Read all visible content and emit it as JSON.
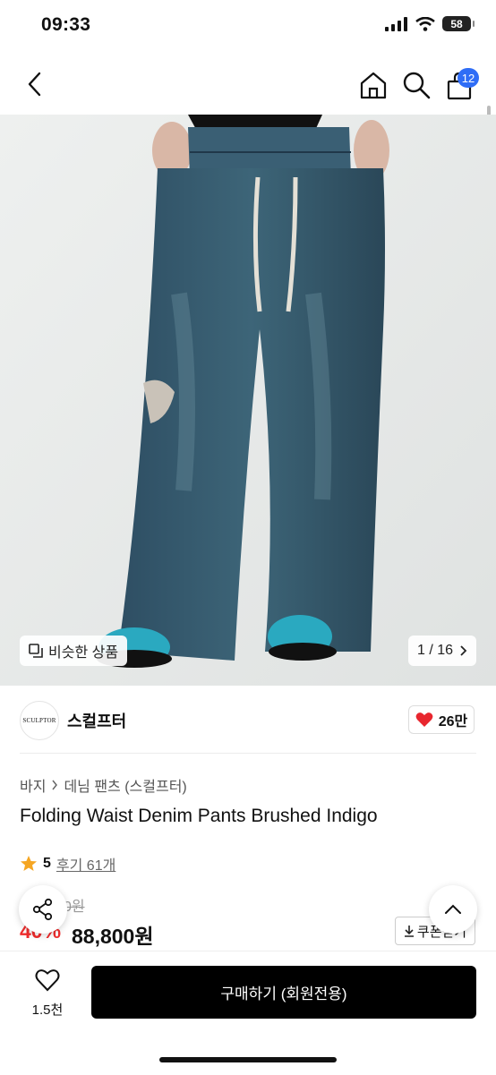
{
  "status": {
    "time": "09:33",
    "battery": "58"
  },
  "nav": {
    "cart_count": "12"
  },
  "gallery": {
    "similar_label": "비슷한 상품",
    "page_indicator": "1 / 16"
  },
  "brand": {
    "logo_text": "SCULPTOR",
    "name": "스컬프터",
    "likes": "26만"
  },
  "breadcrumb": {
    "category": "바지",
    "subcategory": "데님 팬츠 (스컬프터)"
  },
  "product": {
    "title": "Folding Waist Denim Pants Brushed Indigo",
    "rating": "5",
    "reviews": "후기 61개",
    "original_price": "148,000원",
    "discount": "40%",
    "price": "88,800원",
    "coupon_label": "쿠폰받기"
  },
  "bottom": {
    "wish_count": "1.5천",
    "buy_label": "구매하기 (회원전용)"
  },
  "colors": {
    "accent_blue": "#2f6df6",
    "sale_red": "#f02d2d",
    "heart_red": "#e8262e",
    "star": "#f5a623"
  }
}
